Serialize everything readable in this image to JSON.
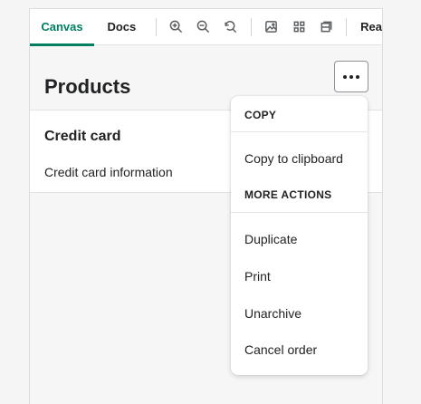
{
  "toolbar": {
    "tabs": {
      "canvas": "Canvas",
      "docs": "Docs",
      "rea": "Rea"
    },
    "tools": [
      "zoom-in-icon",
      "zoom-out-icon",
      "reset-zoom-icon",
      "image-icon",
      "grid-icon",
      "component-icon"
    ]
  },
  "page": {
    "title": "Products",
    "more_actions_glyph": "•••"
  },
  "card": {
    "title": "Credit card",
    "body": "Credit card information"
  },
  "popover": {
    "sections": [
      {
        "title": "COPY",
        "items": [
          "Copy to clipboard"
        ]
      },
      {
        "title": "MORE ACTIONS",
        "items": [
          "Duplicate",
          "Print",
          "Unarchive",
          "Cancel order"
        ]
      }
    ]
  },
  "colors": {
    "accent": "#008060",
    "text": "#202223",
    "border": "#e1e3e5",
    "surface": "#ffffff",
    "background": "#f6f6f7"
  }
}
